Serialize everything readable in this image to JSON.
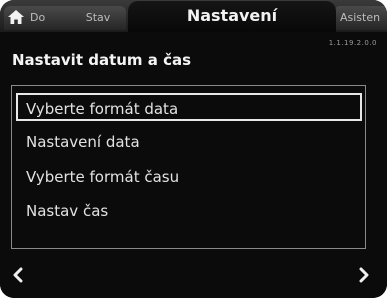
{
  "tabs": {
    "home_label": "Do",
    "stav_label": "Stav",
    "active_label": "Nastavení",
    "asist_label": "Asisten"
  },
  "version": "1.1.19.2.0.0",
  "page": {
    "title": "Nastavit datum a čas"
  },
  "menu": {
    "items": [
      {
        "label": "Vyberte formát data",
        "selected": true
      },
      {
        "label": "Nastavení data",
        "selected": false
      },
      {
        "label": "Vyberte formát času",
        "selected": false
      },
      {
        "label": "Nastav čas",
        "selected": false
      }
    ]
  },
  "nav": {
    "left_icon": "chevron-left-icon",
    "right_icon": "chevron-right-icon"
  }
}
